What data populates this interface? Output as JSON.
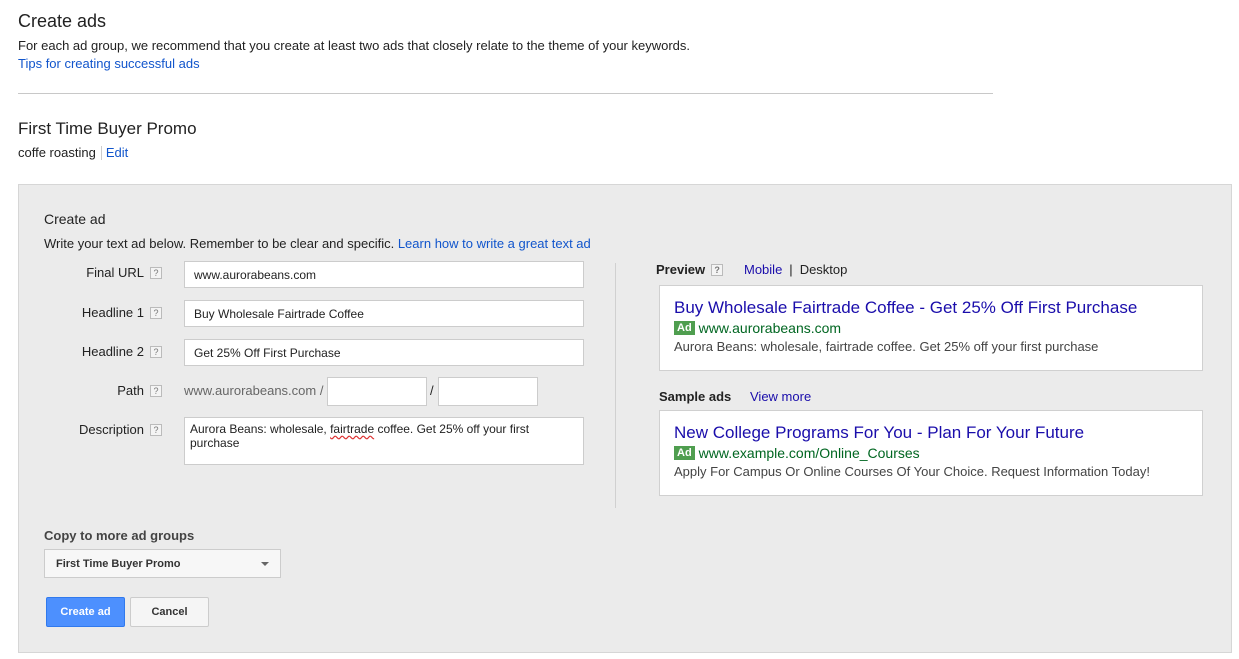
{
  "header": {
    "title": "Create ads",
    "intro": "For each ad group, we recommend that you create at least two ads that closely relate to the theme of your keywords.",
    "tips_link": "Tips for creating successful ads"
  },
  "ad_group": {
    "name": "First Time Buyer Promo",
    "keywords": "coffe roasting",
    "edit_label": "Edit"
  },
  "create_ad": {
    "title": "Create ad",
    "subtitle": "Write your text ad below. Remember to be clear and specific.",
    "learn_link": "Learn how to write a great text ad",
    "help_glyph": "?",
    "fields": {
      "final_url": {
        "label": "Final URL",
        "value": "www.aurorabeans.com"
      },
      "headline1": {
        "label": "Headline 1",
        "value": "Buy Wholesale Fairtrade Coffee"
      },
      "headline2": {
        "label": "Headline 2",
        "value": "Get 25% Off First Purchase"
      },
      "path": {
        "label": "Path",
        "prefix": "www.aurorabeans.com /",
        "separator": "/",
        "path1": "",
        "path2": ""
      },
      "description": {
        "label": "Description",
        "value_before": "Aurora Beans: wholesale, ",
        "value_misspelled": "fairtrade",
        "value_after": " coffee. Get 25% off your first purchase"
      }
    }
  },
  "preview": {
    "label": "Preview",
    "mobile_label": "Mobile",
    "toggle_separator": "|",
    "desktop_label": "Desktop",
    "ad": {
      "headline": "Buy Wholesale Fairtrade Coffee - Get 25% Off First Purchase",
      "badge": "Ad",
      "url": "www.aurorabeans.com",
      "description": "Aurora Beans: wholesale, fairtrade coffee. Get 25% off your first purchase"
    }
  },
  "sample_ads": {
    "label": "Sample ads",
    "view_more": "View more",
    "ad": {
      "headline": "New College Programs For You - Plan For Your Future",
      "badge": "Ad",
      "url": "www.example.com/Online_Courses",
      "description": "Apply For Campus Or Online Courses Of Your Choice. Request Information Today!"
    }
  },
  "copy": {
    "label": "Copy to more ad groups",
    "selected": "First Time Buyer Promo"
  },
  "actions": {
    "create_label": "Create ad",
    "cancel_label": "Cancel"
  },
  "colors": {
    "link": "#1155cc",
    "ad_headline": "#1a0dab",
    "ad_url": "#006621",
    "ad_badge": "#4f9e4f",
    "primary_button": "#4d90fe"
  }
}
